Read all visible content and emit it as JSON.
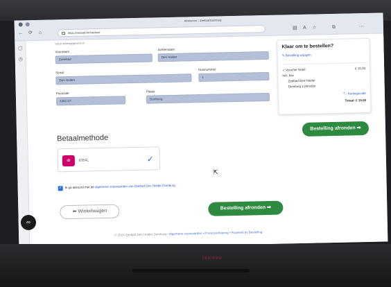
{
  "browser": {
    "tab_title": "Afrekenen – Zeebad Domburg",
    "address": "https://zeebad.nl/checkout",
    "toolbar_icons": [
      "reader-icon",
      "translate-icon",
      "favorite-icon",
      "collections-icon",
      "menu-icon"
    ]
  },
  "form": {
    "hint": "Vul je adresgegevens in",
    "firstname_label": "Voornaam",
    "firstname_value": "Zeeebad",
    "lastname_label": "Achternaam",
    "lastname_value": "Den Holder",
    "street_label": "Straat",
    "street_value": "Den Holder",
    "housenumber_label": "Huisnummer",
    "housenumber_value": "1",
    "postcode_label": "Postcode",
    "postcode_value": "4382 DT",
    "city_label": "Plaats",
    "city_value": "Domburg"
  },
  "summary": {
    "title": "Klaar om te bestellen?",
    "edit_label": "Bestelling wijzigen",
    "item_label": "Voucher Hotel",
    "item_price": "€ 15,00",
    "sub_label": "Incl. btw",
    "detail_1": "Zeebad Den Holder",
    "detail_2": "Domburg 1 persoon",
    "discount_label": "Kortingscode",
    "total_label": "Totaal: € 15,00",
    "finish_button": "Bestelling afronden ➡"
  },
  "payment": {
    "section_title": "Betaalmethode",
    "method_label": "iDEAL",
    "logo_text": "iD"
  },
  "terms": {
    "prefix": "Ik ga akkoord met de",
    "link_text": "algemene voorwaarden van Zeebad Den Holder Domburg"
  },
  "actions": {
    "back_label": "⬅ Winkelwagen",
    "finish_label": "Bestelling afronden ➡"
  },
  "footer": {
    "text": "© 2024 Zeebad Den Holder Domburg •",
    "links": "Algemene voorwaarden • Privacyverklaring • Powered by Bestelling"
  },
  "laptop": {
    "brand": "lenovo"
  },
  "colors": {
    "accent_green": "#2d8a3e",
    "field_blue": "#b3c0d8",
    "link_blue": "#2a59c9",
    "ideal_pink": "#cc0066"
  }
}
